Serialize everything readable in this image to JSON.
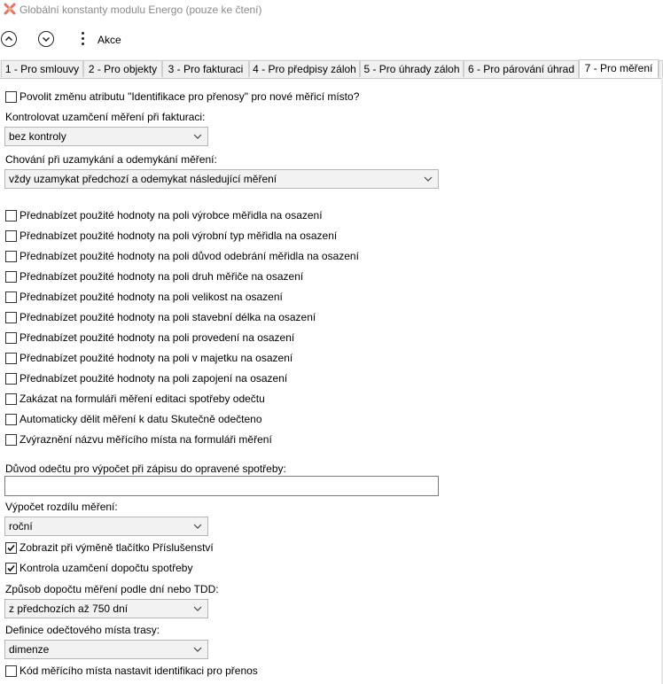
{
  "window": {
    "title": "Globální konstanty modulu Energo (pouze ke čtení)"
  },
  "toolbar": {
    "akce_label": "Akce"
  },
  "tabs": [
    {
      "label": "1 - Pro smlouvy"
    },
    {
      "label": "2 - Pro objekty"
    },
    {
      "label": "3 - Pro fakturaci"
    },
    {
      "label": "4 - Pro předpisy záloh"
    },
    {
      "label": "5 - Pro úhrady záloh"
    },
    {
      "label": "6 - Pro párování úhrad"
    },
    {
      "label": "7 - Pro měření"
    }
  ],
  "form": {
    "povolit_zmenu": {
      "label": "Povolit změnu atributu \"Identifikace pro přenosy\" pro nové měřicí místo?",
      "checked": false
    },
    "kontrolovat_label": "Kontrolovat uzamčení měření při fakturaci:",
    "kontrolovat_value": "bez kontroly",
    "chovani_label": "Chování při uzamykání a odemykání měření:",
    "chovani_value": "vždy uzamykat předchozí a odemykat následující měření",
    "checkboxes": [
      {
        "label": "Přednabízet použité hodnoty na poli výrobce měřidla na osazení",
        "checked": false
      },
      {
        "label": "Přednabízet použité hodnoty na poli výrobní typ měřidla na osazení",
        "checked": false
      },
      {
        "label": "Přednabízet použité hodnoty na poli důvod odebrání měřidla na osazení",
        "checked": false
      },
      {
        "label": "Přednabízet použité hodnoty na poli druh měřiče na osazení",
        "checked": false
      },
      {
        "label": "Přednabízet použité hodnoty na poli velikost na osazení",
        "checked": false
      },
      {
        "label": "Přednabízet použité hodnoty na poli stavební délka na osazení",
        "checked": false
      },
      {
        "label": "Přednabízet použité hodnoty na poli provedení na osazení",
        "checked": false
      },
      {
        "label": "Přednabízet použité hodnoty na poli v majetku na osazení",
        "checked": false
      },
      {
        "label": "Přednabízet použité hodnoty na poli zapojení na osazení",
        "checked": false
      },
      {
        "label": "Zakázat na formuláři měření editaci spotřeby odečtu",
        "checked": false
      },
      {
        "label": "Automaticky dělit měření k datu Skutečně odečteno",
        "checked": false
      },
      {
        "label": "Zvýraznění názvu měřícího místa na formuláři měření",
        "checked": false
      }
    ],
    "duvod_label": "Důvod odečtu pro výpočet při zápisu do opravené spotřeby:",
    "duvod_value": "",
    "vypocet_label": "Výpočet rozdílu měření:",
    "vypocet_value": "roční",
    "zobrazit": {
      "label": "Zobrazit při výměně tlačítko Příslušenství",
      "checked": true
    },
    "kontrola": {
      "label": "Kontrola uzamčení dopočtu spotřeby",
      "checked": true
    },
    "zpusob_label": "Způsob dopočtu měření podle dní nebo TDD:",
    "zpusob_value": "z předchozích až 750 dní",
    "definice_label": "Definice odečtového místa trasy:",
    "definice_value": "dimenze",
    "kod": {
      "label": "Kód měřícího místa nastavit identifikaci pro přenos",
      "checked": false
    }
  }
}
